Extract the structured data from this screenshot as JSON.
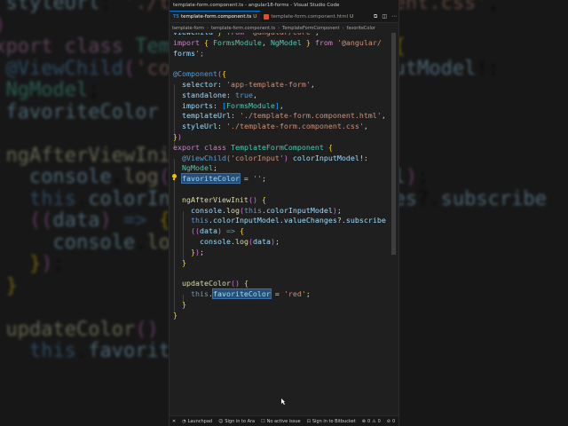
{
  "window": {
    "title": "template-form.component.ts - angular18-forms - Visual Studio Code"
  },
  "tabs": [
    {
      "label": "template-form.component.ts",
      "modified": "U",
      "icon": "typescript-icon",
      "active": true
    },
    {
      "label": "template-form.component.html",
      "modified": "U",
      "icon": "html-icon",
      "active": false
    }
  ],
  "breadcrumb": [
    "template-form",
    "template-form.component.ts",
    "TemplateFormComponent",
    "favoriteColor"
  ],
  "code_lines": [
    "viewChild } from '@angular/core';",
    "import { FormsModule, NgModel } from '@angular/",
    "forms';",
    "",
    "@Component({",
    "  selector: 'app-template-form',",
    "  standalone: true,",
    "  imports: [FormsModule],",
    "  templateUrl: './template-form.component.html',",
    "  styleUrl: './template-form.component.css',",
    "})",
    "export class TemplateFormComponent {",
    "  @ViewChild('colorInput') colorInputModel!:",
    "  NgModel;",
    "  favoriteColor = '';",
    "",
    "  ngAfterViewInit() {",
    "    console.log(this.colorInputModel);",
    "    this.colorInputModel.valueChanges?.subscribe",
    "    ((data) => {",
    "      console.log(data);",
    "    });",
    "  }",
    "",
    "  updateColor() {",
    "    this.favoriteColor = 'red';",
    "  }",
    "}"
  ],
  "status_bar": {
    "launchpad": "Launchpad",
    "sign_in_azure": "Sign in to Ara",
    "active_issue": "No active issue",
    "sign_in_bitbucket": "Sign in to Bitbucket",
    "errors": "0",
    "warnings": "0",
    "other": "0"
  },
  "background_zoom": {
    "lines": [
      "  styleUrl: './template-form.component.css',",
      "})",
      "export class TemplateFormComponent {",
      "  @ViewChild('colorInput') colorInputModel!:",
      "  NgModel;",
      "  favoriteColor = '';",
      "",
      "  ngAfterViewInit() {",
      "    console.log(this.colorInputModel);",
      "    this.colorInputModel.valueChanges?.subscribe",
      "    ((data) => {",
      "      console.log(data);",
      "    });",
      "  }",
      "",
      "  updateColor() {",
      "    this.favoriteColor = 'red';"
    ]
  },
  "colors": {
    "editor_bg": "#1f1f1f",
    "keyword": "#c586c0",
    "string": "#ce9178",
    "class": "#4ec9b0",
    "function": "#dcdcaa",
    "variable": "#9cdcfe",
    "selection": "#264f78"
  }
}
